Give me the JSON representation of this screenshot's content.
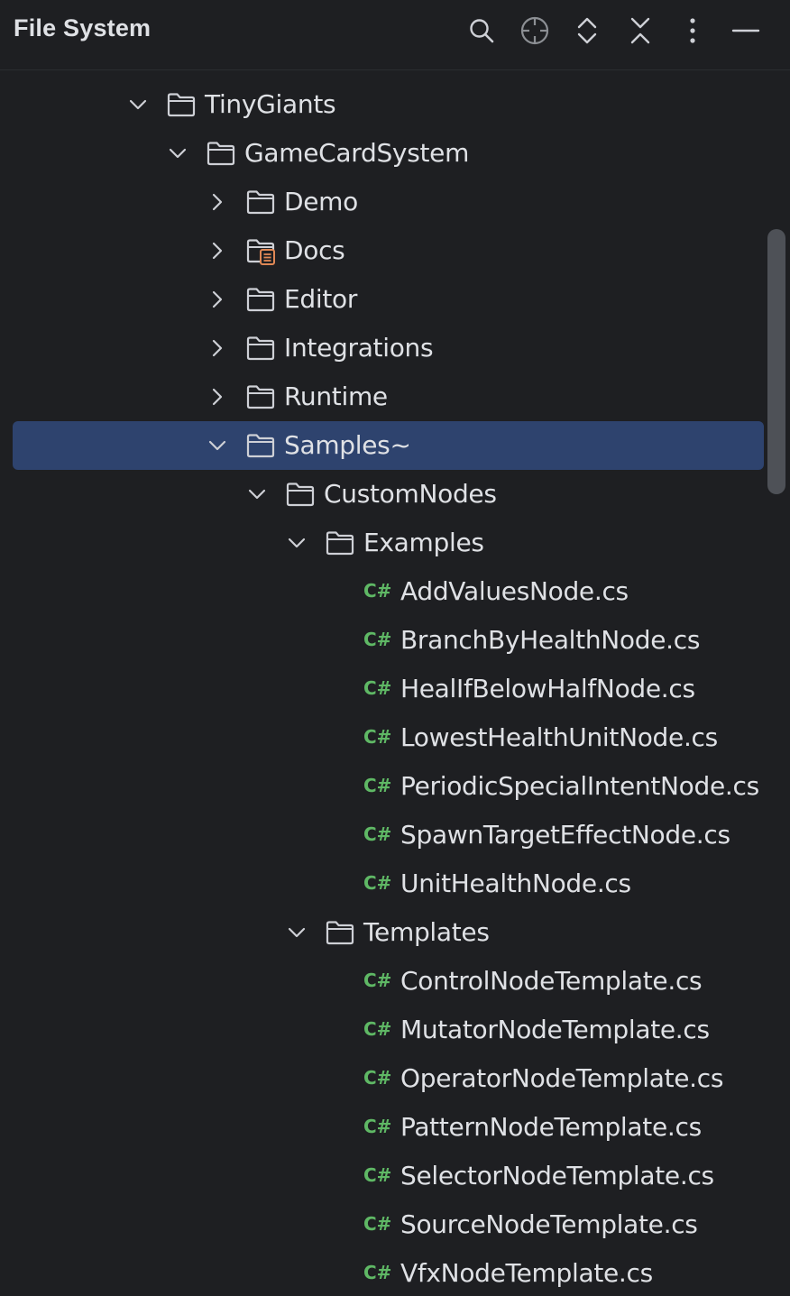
{
  "header": {
    "title": "File System",
    "toolbar": [
      {
        "icon": "search-icon"
      },
      {
        "icon": "locate-icon"
      },
      {
        "icon": "expand-all-icon"
      },
      {
        "icon": "collapse-all-icon"
      },
      {
        "icon": "more-options-icon"
      },
      {
        "icon": "minimize-icon"
      }
    ]
  },
  "colors": {
    "background": "#1e1f22",
    "selection": "#2e436e",
    "text": "#dfe1e5",
    "csharp_badge": "#5fb865",
    "docs_badge": "#e08855",
    "folder_stroke": "#ced0d6"
  },
  "tree": [
    {
      "label": "TinyGiants",
      "type": "folder",
      "expanded": true,
      "depth": 0
    },
    {
      "label": "GameCardSystem",
      "type": "folder",
      "expanded": true,
      "depth": 1
    },
    {
      "label": "Demo",
      "type": "folder",
      "expanded": false,
      "depth": 2
    },
    {
      "label": "Docs",
      "type": "docs-folder",
      "expanded": false,
      "depth": 2
    },
    {
      "label": "Editor",
      "type": "folder",
      "expanded": false,
      "depth": 2
    },
    {
      "label": "Integrations",
      "type": "folder",
      "expanded": false,
      "depth": 2
    },
    {
      "label": "Runtime",
      "type": "folder",
      "expanded": false,
      "depth": 2
    },
    {
      "label": "Samples~",
      "type": "folder",
      "expanded": true,
      "depth": 2,
      "selected": true
    },
    {
      "label": "CustomNodes",
      "type": "folder",
      "expanded": true,
      "depth": 3
    },
    {
      "label": "Examples",
      "type": "folder",
      "expanded": true,
      "depth": 4
    },
    {
      "label": "AddValuesNode.cs",
      "type": "csharp",
      "depth": 5
    },
    {
      "label": "BranchByHealthNode.cs",
      "type": "csharp",
      "depth": 5
    },
    {
      "label": "HealIfBelowHalfNode.cs",
      "type": "csharp",
      "depth": 5
    },
    {
      "label": "LowestHealthUnitNode.cs",
      "type": "csharp",
      "depth": 5
    },
    {
      "label": "PeriodicSpecialIntentNode.cs",
      "type": "csharp",
      "depth": 5
    },
    {
      "label": "SpawnTargetEffectNode.cs",
      "type": "csharp",
      "depth": 5
    },
    {
      "label": "UnitHealthNode.cs",
      "type": "csharp",
      "depth": 5
    },
    {
      "label": "Templates",
      "type": "folder",
      "expanded": true,
      "depth": 4
    },
    {
      "label": "ControlNodeTemplate.cs",
      "type": "csharp",
      "depth": 5
    },
    {
      "label": "MutatorNodeTemplate.cs",
      "type": "csharp",
      "depth": 5
    },
    {
      "label": "OperatorNodeTemplate.cs",
      "type": "csharp",
      "depth": 5
    },
    {
      "label": "PatternNodeTemplate.cs",
      "type": "csharp",
      "depth": 5
    },
    {
      "label": "SelectorNodeTemplate.cs",
      "type": "csharp",
      "depth": 5
    },
    {
      "label": "SourceNodeTemplate.cs",
      "type": "csharp",
      "depth": 5
    },
    {
      "label": "VfxNodeTemplate.cs",
      "type": "csharp",
      "depth": 5
    }
  ],
  "csharp_badge_text": "C#"
}
